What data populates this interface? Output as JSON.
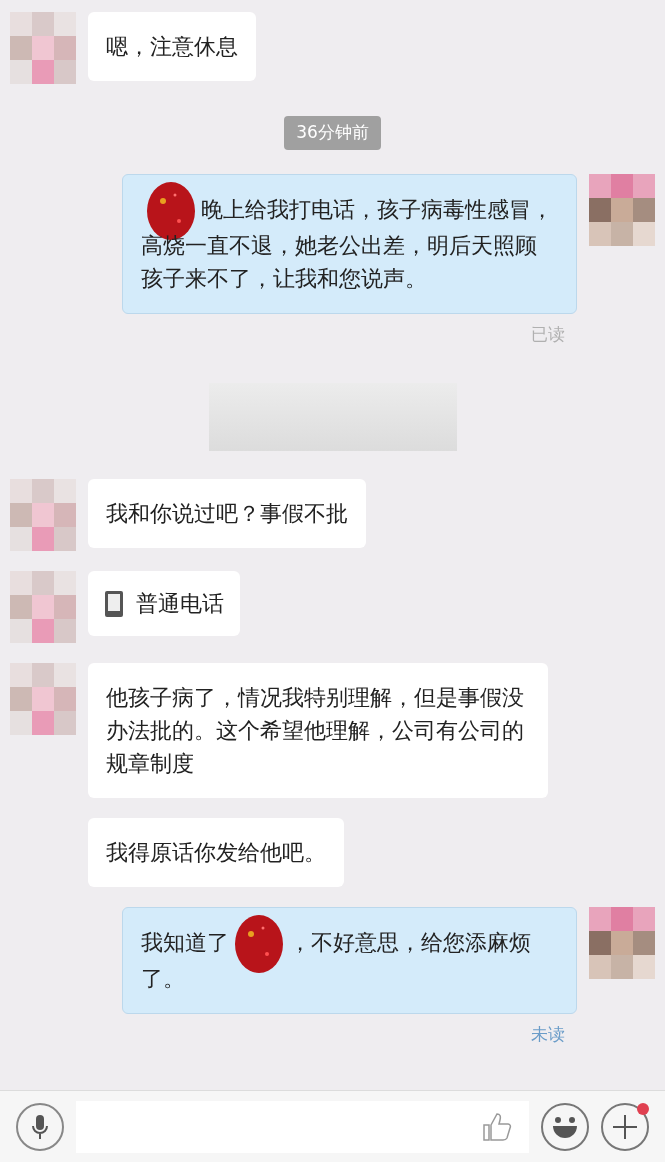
{
  "messages": [
    {
      "kind": "text",
      "outgoing": false,
      "avatar": true,
      "parts": [
        {
          "kind": "text",
          "text": "嗯，注意休息"
        }
      ]
    },
    {
      "kind": "time",
      "text": "36分钟前"
    },
    {
      "kind": "text",
      "outgoing": true,
      "avatar": true,
      "parts": [
        {
          "kind": "redaction"
        },
        {
          "kind": "text",
          "text": "晚上给我打电话，孩子病毒性感冒，高烧一直不退，她老公出差，明后天照顾孩子来不了，让我和您说声。"
        }
      ],
      "status": {
        "text": "已读",
        "read": true
      }
    },
    {
      "kind": "redacted"
    },
    {
      "kind": "text",
      "outgoing": false,
      "avatar": true,
      "parts": [
        {
          "kind": "text",
          "text": "我和你说过吧？事假不批"
        }
      ]
    },
    {
      "kind": "call",
      "outgoing": false,
      "avatar": true,
      "parts": [
        {
          "kind": "text",
          "text": "普通电话"
        }
      ]
    },
    {
      "kind": "text",
      "outgoing": false,
      "avatar": true,
      "parts": [
        {
          "kind": "text",
          "text": "他孩子病了，情况我特别理解，但是事假没办法批的。这个希望他理解，公司有公司的规章制度"
        }
      ]
    },
    {
      "kind": "text",
      "outgoing": false,
      "avatar": false,
      "parts": [
        {
          "kind": "text",
          "text": "我得原话你发给他吧。"
        }
      ]
    },
    {
      "kind": "text",
      "outgoing": true,
      "avatar": true,
      "parts": [
        {
          "kind": "text",
          "text": "我知道了"
        },
        {
          "kind": "redaction"
        },
        {
          "kind": "text",
          "text": "，不好意思，给您添麻烦了。"
        }
      ],
      "status": {
        "text": "未读",
        "read": false
      }
    }
  ],
  "input_bar": {
    "plus_badge": true
  }
}
